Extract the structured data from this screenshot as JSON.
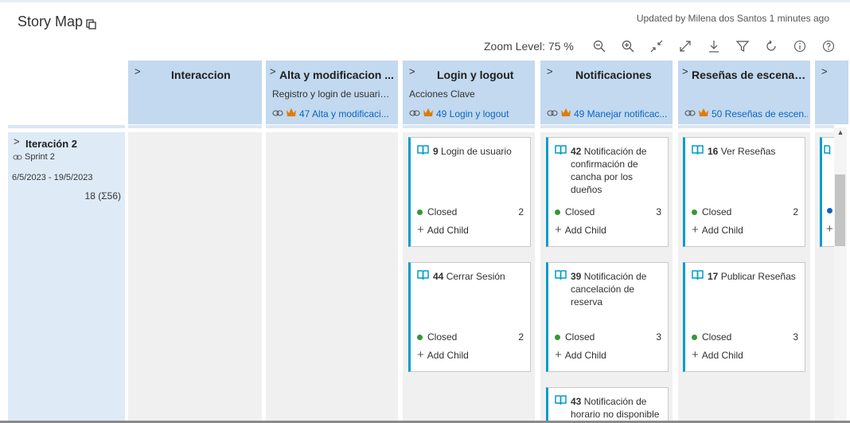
{
  "app": {
    "title": "Story Map",
    "updated": "Updated by Milena dos Santos 1 minutes ago"
  },
  "toolbar": {
    "zoom_label": "Zoom Level: 75 %",
    "icons": [
      "zoom-out-icon",
      "zoom-in-icon",
      "collapse-icon",
      "expand-icon",
      "download-icon",
      "filter-icon",
      "refresh-icon",
      "info-icon",
      "help-icon"
    ]
  },
  "columns": [
    {
      "title": "Interaccion",
      "subtitle": "",
      "link": ""
    },
    {
      "title": "Alta y modificacion ...",
      "subtitle": "Registro y login de usuario...",
      "link": "47 Alta y modificaci..."
    },
    {
      "title": "Login y logout",
      "subtitle": "Acciones Clave",
      "link": "49 Login y logout"
    },
    {
      "title": "Notificaciones",
      "subtitle": "",
      "link": "49 Manejar notificac..."
    },
    {
      "title": "Reseñas de escenari...",
      "subtitle": "",
      "link": "50 Reseñas de escen..."
    }
  ],
  "iteration": {
    "title": "Iteración 2",
    "sprint": "Sprint 2",
    "dates": "6/5/2023 - 19/5/2023",
    "count": "18 (Σ56)"
  },
  "cards": {
    "login": [
      {
        "id": "9",
        "title": "Login de usuario",
        "state": "Closed",
        "points": "2",
        "add": "Add Child"
      },
      {
        "id": "44",
        "title": "Cerrar Sesión",
        "state": "Closed",
        "points": "2",
        "add": "Add Child"
      }
    ],
    "notificaciones": [
      {
        "id": "42",
        "title": "Notificación de confirmación de cancha por los dueños",
        "state": "Closed",
        "points": "3",
        "add": "Add Child"
      },
      {
        "id": "39",
        "title": "Notificación de cancelación de reserva",
        "state": "Closed",
        "points": "3",
        "add": "Add Child"
      },
      {
        "id": "43",
        "title": "Notificación de horario no disponible",
        "state": "",
        "points": "",
        "add": ""
      }
    ],
    "resenas": [
      {
        "id": "16",
        "title": "Ver Reseñas",
        "state": "Closed",
        "points": "2",
        "add": "Add Child"
      },
      {
        "id": "17",
        "title": "Publicar Reseñas",
        "state": "Closed",
        "points": "3",
        "add": "Add Child"
      }
    ]
  },
  "colors": {
    "header_bg": "#c2d9ef",
    "iteration_bg": "#deebf7",
    "card_accent": "#009ccc",
    "closed_dot": "#339933",
    "link": "#0a66c2",
    "crown": "#e07b00"
  }
}
